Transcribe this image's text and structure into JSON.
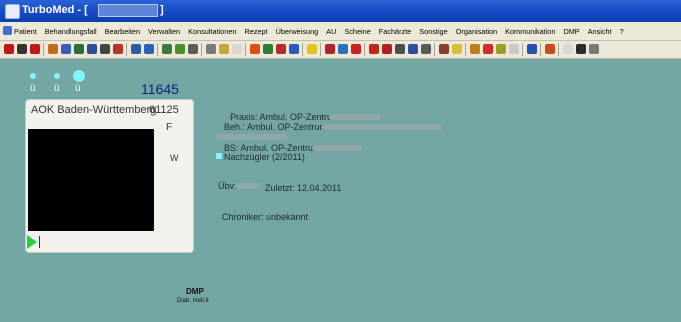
{
  "app": {
    "title": "TurboMed - [",
    "title_suffix": "]"
  },
  "menu": [
    "Patient",
    "Behandlungsfall",
    "Bearbeiten",
    "Verwalten",
    "Konsultationen",
    "Rezept",
    "Überweisung",
    "AU",
    "Scheine",
    "Fachärzte",
    "Sonstige",
    "Organisation",
    "Kommunikation",
    "DMP",
    "Ansicht",
    "?"
  ],
  "status_dots": {
    "labels": [
      "ü",
      "ü",
      "ü"
    ]
  },
  "patient": {
    "number": "11645",
    "insurance": "AOK Baden-Württemberg",
    "insurance_code": "61125",
    "letter_f": "F",
    "letter_w": "W",
    "input_value": ""
  },
  "info": {
    "praxis": "Praxis: Ambul. OP-Zentrum",
    "beh": "Beh.: Ambul. OP-Zentrum",
    "bs": "BS: Ambul. OP-Zentrum",
    "nachzuegler": "Nachzügler (2/2011)",
    "ubv_label": "Übv:",
    "zuletzt": "Zuletzt: 12.04.2011",
    "chroniker": "Chroniker: unbekannt"
  },
  "dmp": {
    "title": "DMP",
    "subtitle": "Diab. mell.II"
  },
  "colors": {
    "background": "#73a6a3",
    "titlebar": "#1448c4",
    "accent_dot": "#7ff5ff",
    "patient_number": "#0b1e86",
    "play": "#22d33a"
  },
  "toolbar_icons": [
    "arrow-left-icon",
    "binoculars-icon",
    "arrow-right-icon",
    "patient-icon",
    "patient-list-icon",
    "card-icon",
    "card2-icon",
    "card3-icon",
    "chart-icon",
    "monitor-icon",
    "notes-icon",
    "calendar-icon",
    "plant-icon",
    "stethoscope-icon",
    "pill-icon",
    "lab-icon",
    "arrow-right-icon",
    "graph-icon",
    "table-icon",
    "screen-icon",
    "folder-icon",
    "med-icon",
    "ok-icon",
    "add-icon",
    "stat-icon",
    "grid-icon",
    "tool-icon",
    "pin-icon",
    "tools-icon",
    "book-icon",
    "folder-icon",
    "cam-icon",
    "disk-icon",
    "shield-icon",
    "percent-icon",
    "globe-icon",
    "more-icon"
  ]
}
